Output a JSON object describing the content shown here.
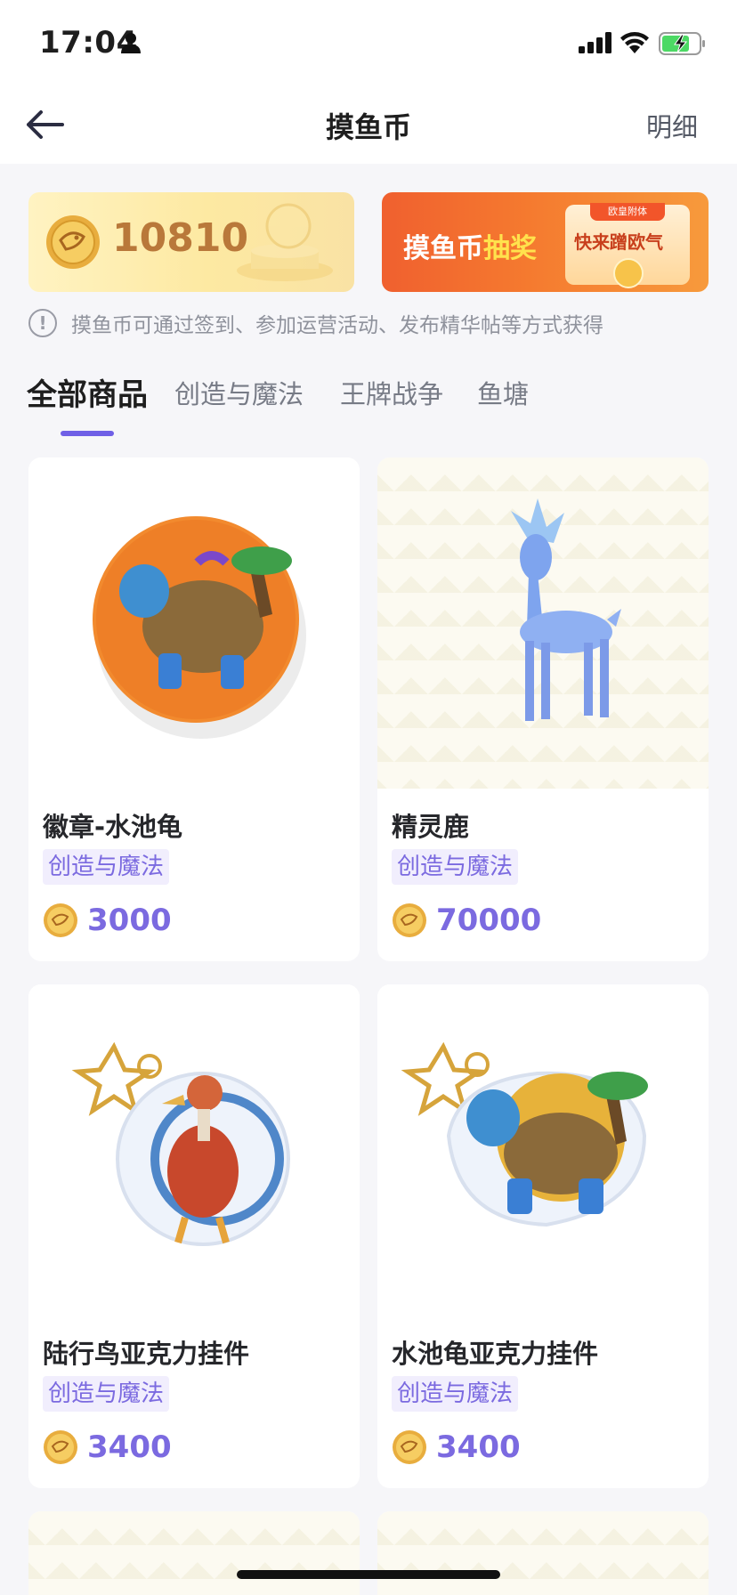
{
  "status_bar": {
    "time": "17:04"
  },
  "nav": {
    "title": "摸鱼币",
    "right_label": "明细"
  },
  "banner": {
    "coins": "10810",
    "lottery_title_a": "摸鱼币",
    "lottery_title_b": "抽奖",
    "lottery_tag": "欧皇附体",
    "lottery_cta": "快来蹭欧气"
  },
  "info": {
    "text": "摸鱼币可通过签到、参加运营活动、发布精华帖等方式获得"
  },
  "tabs": [
    {
      "label": "全部商品",
      "active": true
    },
    {
      "label": "创造与魔法",
      "active": false
    },
    {
      "label": "王牌战争",
      "active": false
    },
    {
      "label": "鱼塘",
      "active": false
    }
  ],
  "products": [
    {
      "name": "徽章-水池龟",
      "tag": "创造与魔法",
      "price": "3000",
      "image": "badge-turtle"
    },
    {
      "name": "精灵鹿",
      "tag": "创造与魔法",
      "price": "70000",
      "image": "spirit-deer"
    },
    {
      "name": "陆行鸟亚克力挂件",
      "tag": "创造与魔法",
      "price": "3400",
      "image": "bird-keychain"
    },
    {
      "name": "水池龟亚克力挂件",
      "tag": "创造与魔法",
      "price": "3400",
      "image": "turtle-keychain"
    }
  ],
  "colors": {
    "accent": "#7b6ae0",
    "coin": "#e9b448",
    "lottery": "#f0602f"
  }
}
